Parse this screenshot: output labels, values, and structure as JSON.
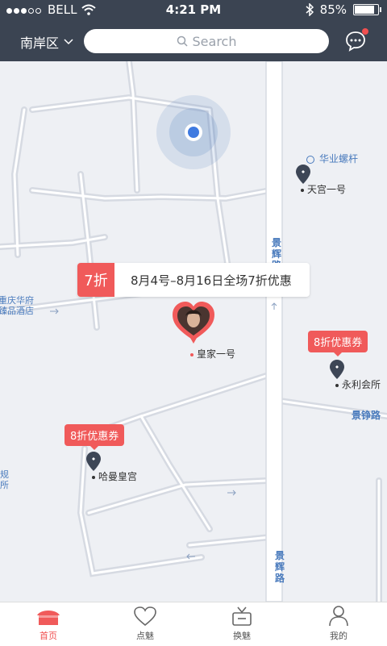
{
  "status": {
    "carrier": "BELL",
    "time": "4:21 PM",
    "battery": "85%"
  },
  "header": {
    "district": "南岸区",
    "search_placeholder": "Search"
  },
  "map": {
    "promo": {
      "badge": "7折",
      "text": "8月4号–8月16日全场7折优惠"
    },
    "places": {
      "main": "皇家一号",
      "tiangong": "天宫一号",
      "huaye": "华业螺杆",
      "yongli": "永利会所",
      "haman": "哈曼皇宫",
      "chongqing_hotel_1": "重庆华府",
      "chongqing_hotel_2": "臻品酒店",
      "left_edge_1": "规",
      "left_edge_2": "所"
    },
    "coupons": {
      "yongli": "8折优惠券",
      "haman": "8折优惠券"
    },
    "roads": {
      "jinghui_top": "景辉路",
      "jinghui_bottom": "景辉路",
      "jingzheng": "景铮路"
    }
  },
  "tabs": [
    {
      "label": "首页",
      "icon": "home-icon",
      "active": true
    },
    {
      "label": "点魅",
      "icon": "heart-icon",
      "active": false
    },
    {
      "label": "换魅",
      "icon": "gift-tv-icon",
      "active": false
    },
    {
      "label": "我的",
      "icon": "user-icon",
      "active": false
    }
  ],
  "colors": {
    "nav_bg": "#3b4452",
    "accent": "#f05a5a",
    "location_blue": "#4a7bbd"
  }
}
